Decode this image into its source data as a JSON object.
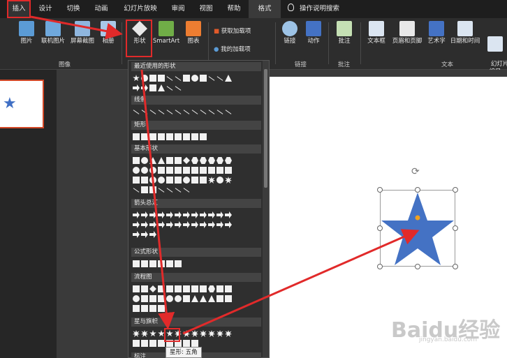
{
  "tabs": [
    {
      "label": "插入",
      "active": true
    },
    {
      "label": "设计"
    },
    {
      "label": "切换"
    },
    {
      "label": "动画"
    },
    {
      "label": "幻灯片放映"
    },
    {
      "label": "审阅"
    },
    {
      "label": "视图"
    },
    {
      "label": "帮助"
    },
    {
      "label": "格式"
    }
  ],
  "tell_me": "操作说明搜索",
  "ribbon": {
    "picture": "图片",
    "online_picture": "联机图片",
    "screenshot": "屏幕截图",
    "album": "相册",
    "group_images": "图像",
    "shapes": "形状",
    "smartart": "SmartArt",
    "chart": "图表",
    "get_addins": "获取加载项",
    "my_addins": "我的加载项",
    "link": "链接",
    "action": "动作",
    "group_links": "链接",
    "comment": "批注",
    "group_comments": "批注",
    "textbox": "文本框",
    "header_footer": "页眉和页脚",
    "wordart": "艺术字",
    "datetime": "日期和时间",
    "slide_number": "幻灯片\n编号",
    "group_text": "文本"
  },
  "gallery": {
    "categories": [
      "最近使用的形状",
      "线条",
      "矩形",
      "基本形状",
      "箭头总汇",
      "公式形状",
      "流程图",
      "星与旗帜",
      "标注"
    ],
    "tooltip": "星形: 五角"
  },
  "watermark": {
    "brand": "Baidu经验",
    "url": "jingyan.baidu.com"
  },
  "colors": {
    "accent_red": "#e12a2a",
    "star_blue": "#4472c4",
    "thumb_border": "#d24726"
  }
}
